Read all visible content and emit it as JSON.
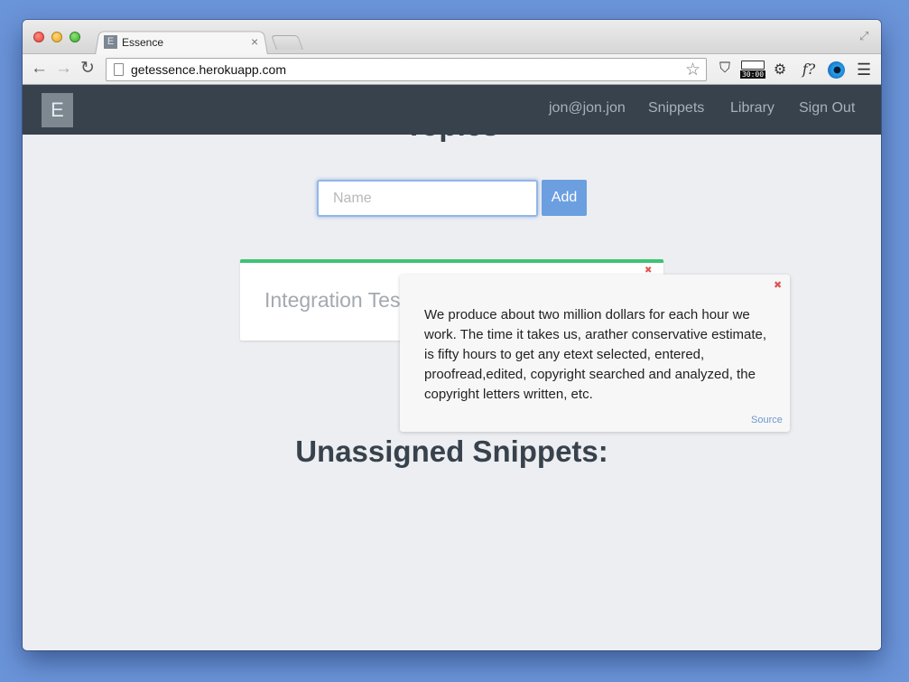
{
  "browser": {
    "tab_title": "Essence",
    "tab_favicon": "E",
    "tab_close": "×",
    "url": "getessence.herokuapp.com",
    "icons": [
      "back-icon",
      "forward-icon",
      "reload-icon",
      "page-icon",
      "star-icon",
      "pocket-icon",
      "timer-icon",
      "gear-icon",
      "formula-icon",
      "eye-icon",
      "menu-icon",
      "fullscreen-icon"
    ],
    "timer_text": "30:00",
    "formula_text": "f?"
  },
  "app_nav": {
    "brand": "E",
    "links": {
      "user": "jon@jon.jon",
      "snippets": "Snippets",
      "library": "Library",
      "sign_out": "Sign Out"
    }
  },
  "topics": {
    "heading": "Topics",
    "name_placeholder": "Name",
    "add_label": "Add",
    "cards": [
      {
        "title": "Integration Tes",
        "delete": "✖"
      }
    ]
  },
  "snippet_popup": {
    "close": "✖",
    "text": "We produce about two million dollars for each hour we work. The time it takes us, arather conservative estimate, is fifty hours to get any etext selected, entered, proofread,edited, copyright searched and analyzed, the copyright letters written, etc.",
    "source_label": "Source"
  },
  "unassigned": {
    "heading": "Unassigned Snippets:"
  },
  "colors": {
    "navbar": "#38424c",
    "accent_green": "#3fc275",
    "button_blue": "#6b9fe0",
    "delete_red": "#e05555",
    "page_bg": "#eceef1"
  }
}
